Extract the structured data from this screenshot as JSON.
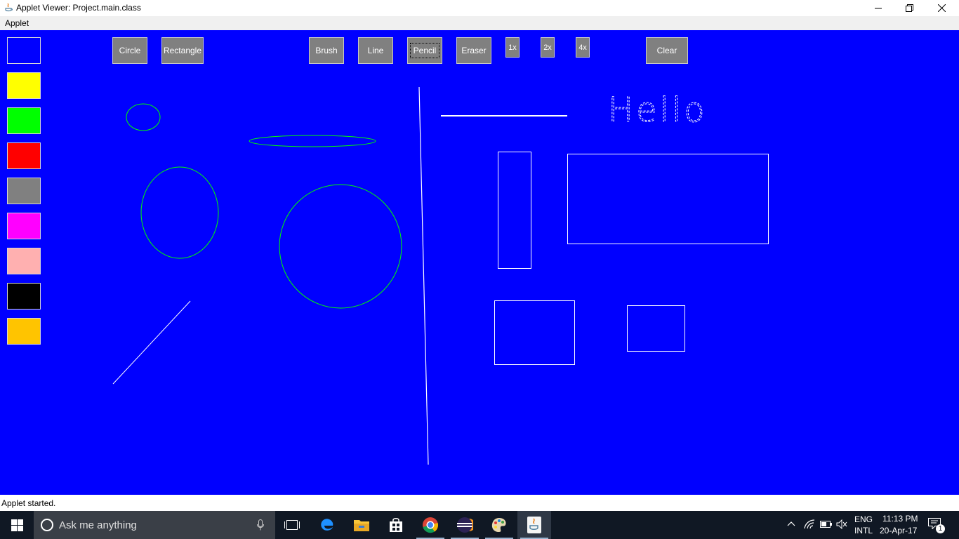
{
  "window": {
    "title": "Applet Viewer: Project.main.class",
    "menu": [
      "Applet"
    ],
    "status": "Applet started."
  },
  "canvas": {
    "background_color": "#0000ff",
    "palette": [
      {
        "name": "blue",
        "color": "#0000ff"
      },
      {
        "name": "yellow",
        "color": "#ffff00"
      },
      {
        "name": "green",
        "color": "#00ff00"
      },
      {
        "name": "red",
        "color": "#ff0000"
      },
      {
        "name": "gray",
        "color": "#808080"
      },
      {
        "name": "magenta",
        "color": "#ff00ff"
      },
      {
        "name": "pink",
        "color": "#ffb0b0"
      },
      {
        "name": "black",
        "color": "#000000"
      },
      {
        "name": "orange",
        "color": "#ffc400"
      }
    ],
    "tools": {
      "circle": "Circle",
      "rectangle": "Rectangle",
      "brush": "Brush",
      "line": "Line",
      "pencil": "Pencil",
      "eraser": "Eraser",
      "size_1x": "1x",
      "size_2x": "2x",
      "size_4x": "4x",
      "clear": "Clear"
    },
    "selected_tool": "Pencil",
    "drawn_text": "Hello"
  },
  "taskbar": {
    "search_placeholder": "Ask me anything",
    "apps": [
      "task-view",
      "edge",
      "file-explorer",
      "store",
      "chrome",
      "eclipse",
      "paint",
      "java"
    ],
    "language": "ENG",
    "keyboard": "INTL",
    "time": "11:13 PM",
    "date": "20-Apr-17",
    "notification_count": "1"
  }
}
